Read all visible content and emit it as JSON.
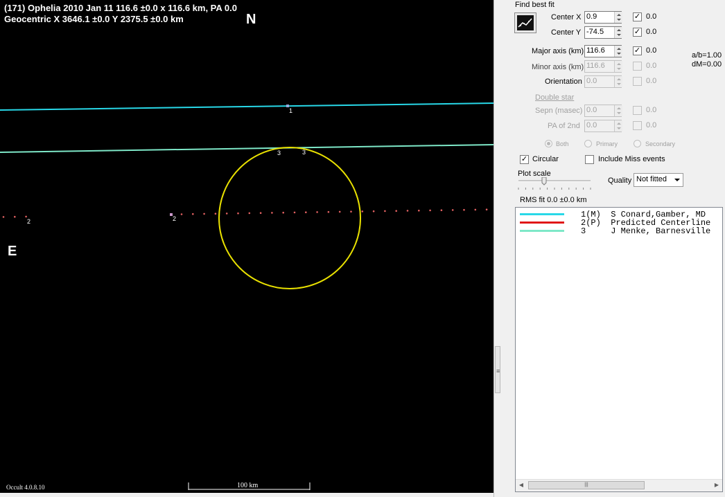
{
  "plot": {
    "title_line1": "(171) Ophelia  2010 Jan 11   116.6 ±0.0 x 116.6 km, PA 0.0",
    "title_line2": "Geocentric  X  3646.1 ±0.0   Y 2375.5 ±0.0 km",
    "north_label": "N",
    "east_label": "E",
    "version": "Occult 4.0.8.10",
    "scale_label": "100 km",
    "chord_label_1": "1",
    "chord_label_2a": "2",
    "chord_label_2b": "2",
    "chord_label_3a": "3",
    "chord_label_3b": "3",
    "colors": {
      "background": "#000000",
      "chord1": "#28d8e8",
      "chord2": "#e06060",
      "chord3": "#7ee8c8",
      "ellipse": "#e8e000"
    }
  },
  "panel": {
    "find_best_fit": "Find best fit",
    "fit_button_icon": "fit-chart-icon",
    "center_x_label": "Center X",
    "center_x_value": "0.9",
    "center_x_fit": "0.0",
    "center_y_label": "Center Y",
    "center_y_value": "-74.5",
    "center_y_fit": "0.0",
    "major_axis_label": "Major axis (km)",
    "major_axis_value": "116.6",
    "major_axis_fit": "0.0",
    "minor_axis_label": "Minor axis (km)",
    "minor_axis_value": "116.6",
    "minor_axis_fit": "0.0",
    "orientation_label": "Orientation",
    "orientation_value": "0.0",
    "orientation_fit": "0.0",
    "ab_ratio": "a/b=1.00",
    "dm": "dM=0.00",
    "double_star_label": "Double star",
    "sepn_label": "Sepn (masec)",
    "sepn_value": "0.0",
    "sepn_fit": "0.0",
    "pa2_label": "PA of 2nd",
    "pa2_value": "0.0",
    "pa2_fit": "0.0",
    "radio_both": "Both",
    "radio_primary": "Primary",
    "radio_secondary": "Secondary",
    "circular_label": "Circular",
    "include_miss_label": "Include Miss events",
    "plot_scale_label": "Plot scale",
    "quality_label": "Quality",
    "quality_value": "Not fitted",
    "rms_fit": "RMS fit  0.0 ±0.0 km",
    "legend": [
      {
        "text": "1(M)  S Conard,Gamber, MD",
        "color": "#28d8e8"
      },
      {
        "text": "2(P)  Predicted Centerline",
        "color": "#e01818"
      },
      {
        "text": "3     J Menke, Barnesville",
        "color": "#7ee8c8"
      }
    ]
  }
}
